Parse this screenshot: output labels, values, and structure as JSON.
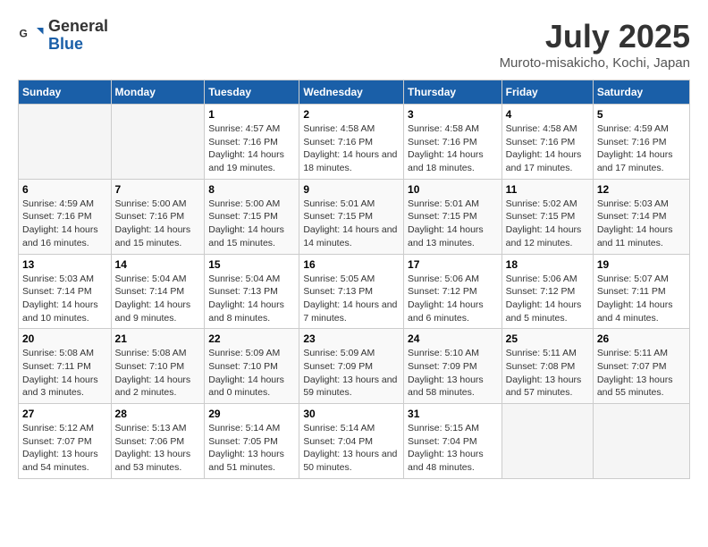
{
  "header": {
    "logo_line1": "General",
    "logo_line2": "Blue",
    "month_title": "July 2025",
    "location": "Muroto-misakicho, Kochi, Japan"
  },
  "days_of_week": [
    "Sunday",
    "Monday",
    "Tuesday",
    "Wednesday",
    "Thursday",
    "Friday",
    "Saturday"
  ],
  "weeks": [
    [
      {
        "day": "",
        "info": ""
      },
      {
        "day": "",
        "info": ""
      },
      {
        "day": "1",
        "info": "Sunrise: 4:57 AM\nSunset: 7:16 PM\nDaylight: 14 hours and 19 minutes."
      },
      {
        "day": "2",
        "info": "Sunrise: 4:58 AM\nSunset: 7:16 PM\nDaylight: 14 hours and 18 minutes."
      },
      {
        "day": "3",
        "info": "Sunrise: 4:58 AM\nSunset: 7:16 PM\nDaylight: 14 hours and 18 minutes."
      },
      {
        "day": "4",
        "info": "Sunrise: 4:58 AM\nSunset: 7:16 PM\nDaylight: 14 hours and 17 minutes."
      },
      {
        "day": "5",
        "info": "Sunrise: 4:59 AM\nSunset: 7:16 PM\nDaylight: 14 hours and 17 minutes."
      }
    ],
    [
      {
        "day": "6",
        "info": "Sunrise: 4:59 AM\nSunset: 7:16 PM\nDaylight: 14 hours and 16 minutes."
      },
      {
        "day": "7",
        "info": "Sunrise: 5:00 AM\nSunset: 7:16 PM\nDaylight: 14 hours and 15 minutes."
      },
      {
        "day": "8",
        "info": "Sunrise: 5:00 AM\nSunset: 7:15 PM\nDaylight: 14 hours and 15 minutes."
      },
      {
        "day": "9",
        "info": "Sunrise: 5:01 AM\nSunset: 7:15 PM\nDaylight: 14 hours and 14 minutes."
      },
      {
        "day": "10",
        "info": "Sunrise: 5:01 AM\nSunset: 7:15 PM\nDaylight: 14 hours and 13 minutes."
      },
      {
        "day": "11",
        "info": "Sunrise: 5:02 AM\nSunset: 7:15 PM\nDaylight: 14 hours and 12 minutes."
      },
      {
        "day": "12",
        "info": "Sunrise: 5:03 AM\nSunset: 7:14 PM\nDaylight: 14 hours and 11 minutes."
      }
    ],
    [
      {
        "day": "13",
        "info": "Sunrise: 5:03 AM\nSunset: 7:14 PM\nDaylight: 14 hours and 10 minutes."
      },
      {
        "day": "14",
        "info": "Sunrise: 5:04 AM\nSunset: 7:14 PM\nDaylight: 14 hours and 9 minutes."
      },
      {
        "day": "15",
        "info": "Sunrise: 5:04 AM\nSunset: 7:13 PM\nDaylight: 14 hours and 8 minutes."
      },
      {
        "day": "16",
        "info": "Sunrise: 5:05 AM\nSunset: 7:13 PM\nDaylight: 14 hours and 7 minutes."
      },
      {
        "day": "17",
        "info": "Sunrise: 5:06 AM\nSunset: 7:12 PM\nDaylight: 14 hours and 6 minutes."
      },
      {
        "day": "18",
        "info": "Sunrise: 5:06 AM\nSunset: 7:12 PM\nDaylight: 14 hours and 5 minutes."
      },
      {
        "day": "19",
        "info": "Sunrise: 5:07 AM\nSunset: 7:11 PM\nDaylight: 14 hours and 4 minutes."
      }
    ],
    [
      {
        "day": "20",
        "info": "Sunrise: 5:08 AM\nSunset: 7:11 PM\nDaylight: 14 hours and 3 minutes."
      },
      {
        "day": "21",
        "info": "Sunrise: 5:08 AM\nSunset: 7:10 PM\nDaylight: 14 hours and 2 minutes."
      },
      {
        "day": "22",
        "info": "Sunrise: 5:09 AM\nSunset: 7:10 PM\nDaylight: 14 hours and 0 minutes."
      },
      {
        "day": "23",
        "info": "Sunrise: 5:09 AM\nSunset: 7:09 PM\nDaylight: 13 hours and 59 minutes."
      },
      {
        "day": "24",
        "info": "Sunrise: 5:10 AM\nSunset: 7:09 PM\nDaylight: 13 hours and 58 minutes."
      },
      {
        "day": "25",
        "info": "Sunrise: 5:11 AM\nSunset: 7:08 PM\nDaylight: 13 hours and 57 minutes."
      },
      {
        "day": "26",
        "info": "Sunrise: 5:11 AM\nSunset: 7:07 PM\nDaylight: 13 hours and 55 minutes."
      }
    ],
    [
      {
        "day": "27",
        "info": "Sunrise: 5:12 AM\nSunset: 7:07 PM\nDaylight: 13 hours and 54 minutes."
      },
      {
        "day": "28",
        "info": "Sunrise: 5:13 AM\nSunset: 7:06 PM\nDaylight: 13 hours and 53 minutes."
      },
      {
        "day": "29",
        "info": "Sunrise: 5:14 AM\nSunset: 7:05 PM\nDaylight: 13 hours and 51 minutes."
      },
      {
        "day": "30",
        "info": "Sunrise: 5:14 AM\nSunset: 7:04 PM\nDaylight: 13 hours and 50 minutes."
      },
      {
        "day": "31",
        "info": "Sunrise: 5:15 AM\nSunset: 7:04 PM\nDaylight: 13 hours and 48 minutes."
      },
      {
        "day": "",
        "info": ""
      },
      {
        "day": "",
        "info": ""
      }
    ]
  ]
}
